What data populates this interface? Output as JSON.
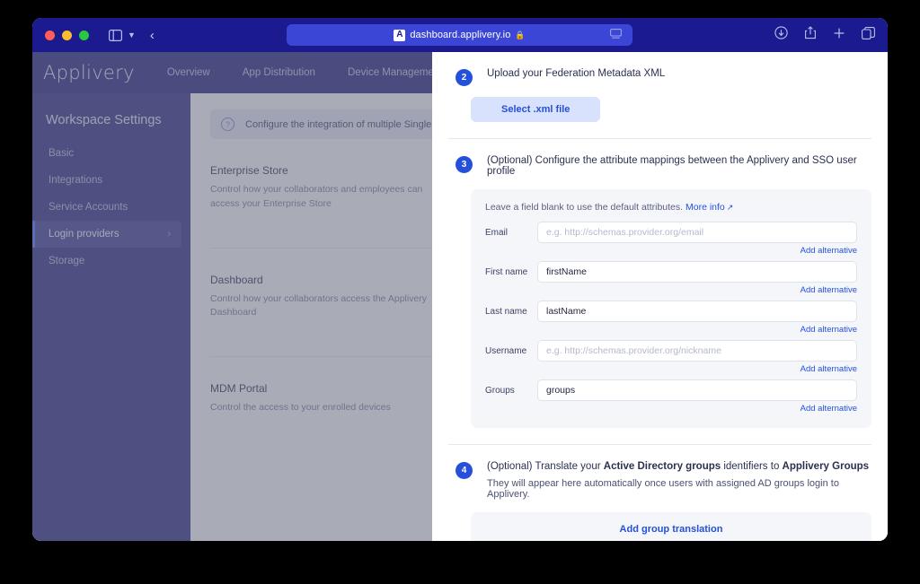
{
  "browser": {
    "url": "dashboard.applivery.io",
    "favicon_glyph": "A",
    "lock_icon": "lock-icon",
    "controls": {
      "sidebar_toggle": "sidebar-toggle-icon",
      "chevron": "chevron-down-icon",
      "back": "back-arrow-icon"
    },
    "right_icons": [
      {
        "name": "download-icon",
        "glyph": "⬇"
      },
      {
        "name": "share-icon",
        "glyph": "⤴"
      },
      {
        "name": "new-tab-icon",
        "glyph": "+"
      },
      {
        "name": "tabs-overview-icon",
        "glyph": "⧉"
      }
    ]
  },
  "app": {
    "logo": "Applivery",
    "nav": [
      {
        "label": "Overview"
      },
      {
        "label": "App Distribution"
      },
      {
        "label": "Device Management"
      }
    ],
    "sidebar": {
      "title": "Workspace Settings",
      "items": [
        {
          "label": "Basic",
          "active": false
        },
        {
          "label": "Integrations",
          "active": false
        },
        {
          "label": "Service Accounts",
          "active": false
        },
        {
          "label": "Login providers",
          "active": true
        },
        {
          "label": "Storage",
          "active": false
        }
      ]
    },
    "info_banner": "Configure the integration of multiple Single Sign-O",
    "sections": [
      {
        "title": "Enterprise Store",
        "desc": "Control how your collaborators and employees can access your Enterprise Store"
      },
      {
        "title": "Dashboard",
        "desc": "Control how your collaborators access the Applivery Dashboard"
      },
      {
        "title": "MDM Portal",
        "desc": "Control the access to your enrolled devices"
      }
    ]
  },
  "modal": {
    "step2": {
      "number": "2",
      "title": "Upload your Federation Metadata XML",
      "button_label": "Select .xml file"
    },
    "step3": {
      "number": "3",
      "title": "(Optional) Configure the attribute mappings between the Applivery and SSO user profile",
      "hint_prefix": "Leave a field blank to use the default attributes.",
      "more_info_label": "More info",
      "add_alternative_label": "Add alternative",
      "fields": [
        {
          "label": "Email",
          "value": "",
          "placeholder": "e.g. http://schemas.provider.org/email"
        },
        {
          "label": "First name",
          "value": "firstName",
          "placeholder": ""
        },
        {
          "label": "Last name",
          "value": "lastName",
          "placeholder": ""
        },
        {
          "label": "Username",
          "value": "",
          "placeholder": "e.g. http://schemas.provider.org/nickname"
        },
        {
          "label": "Groups",
          "value": "groups",
          "placeholder": ""
        }
      ]
    },
    "step4": {
      "number": "4",
      "title_part1": "(Optional) Translate your ",
      "title_bold1": "Active Directory groups",
      "title_part2": " identifiers to ",
      "title_bold2": "Applivery Groups",
      "subtitle": "They will appear here automatically once users with assigned AD groups login to Applivery.",
      "add_button_label": "Add group translation"
    }
  },
  "colors": {
    "chrome_bg": "#1b1b8f",
    "url_bar": "#3b46d6",
    "app_nav": "#22227e",
    "app_sidebar": "#2a2a84",
    "accent_blue": "#2450dc",
    "button_soft": "#d9e2fd",
    "card_bg": "#f4f6fa"
  }
}
